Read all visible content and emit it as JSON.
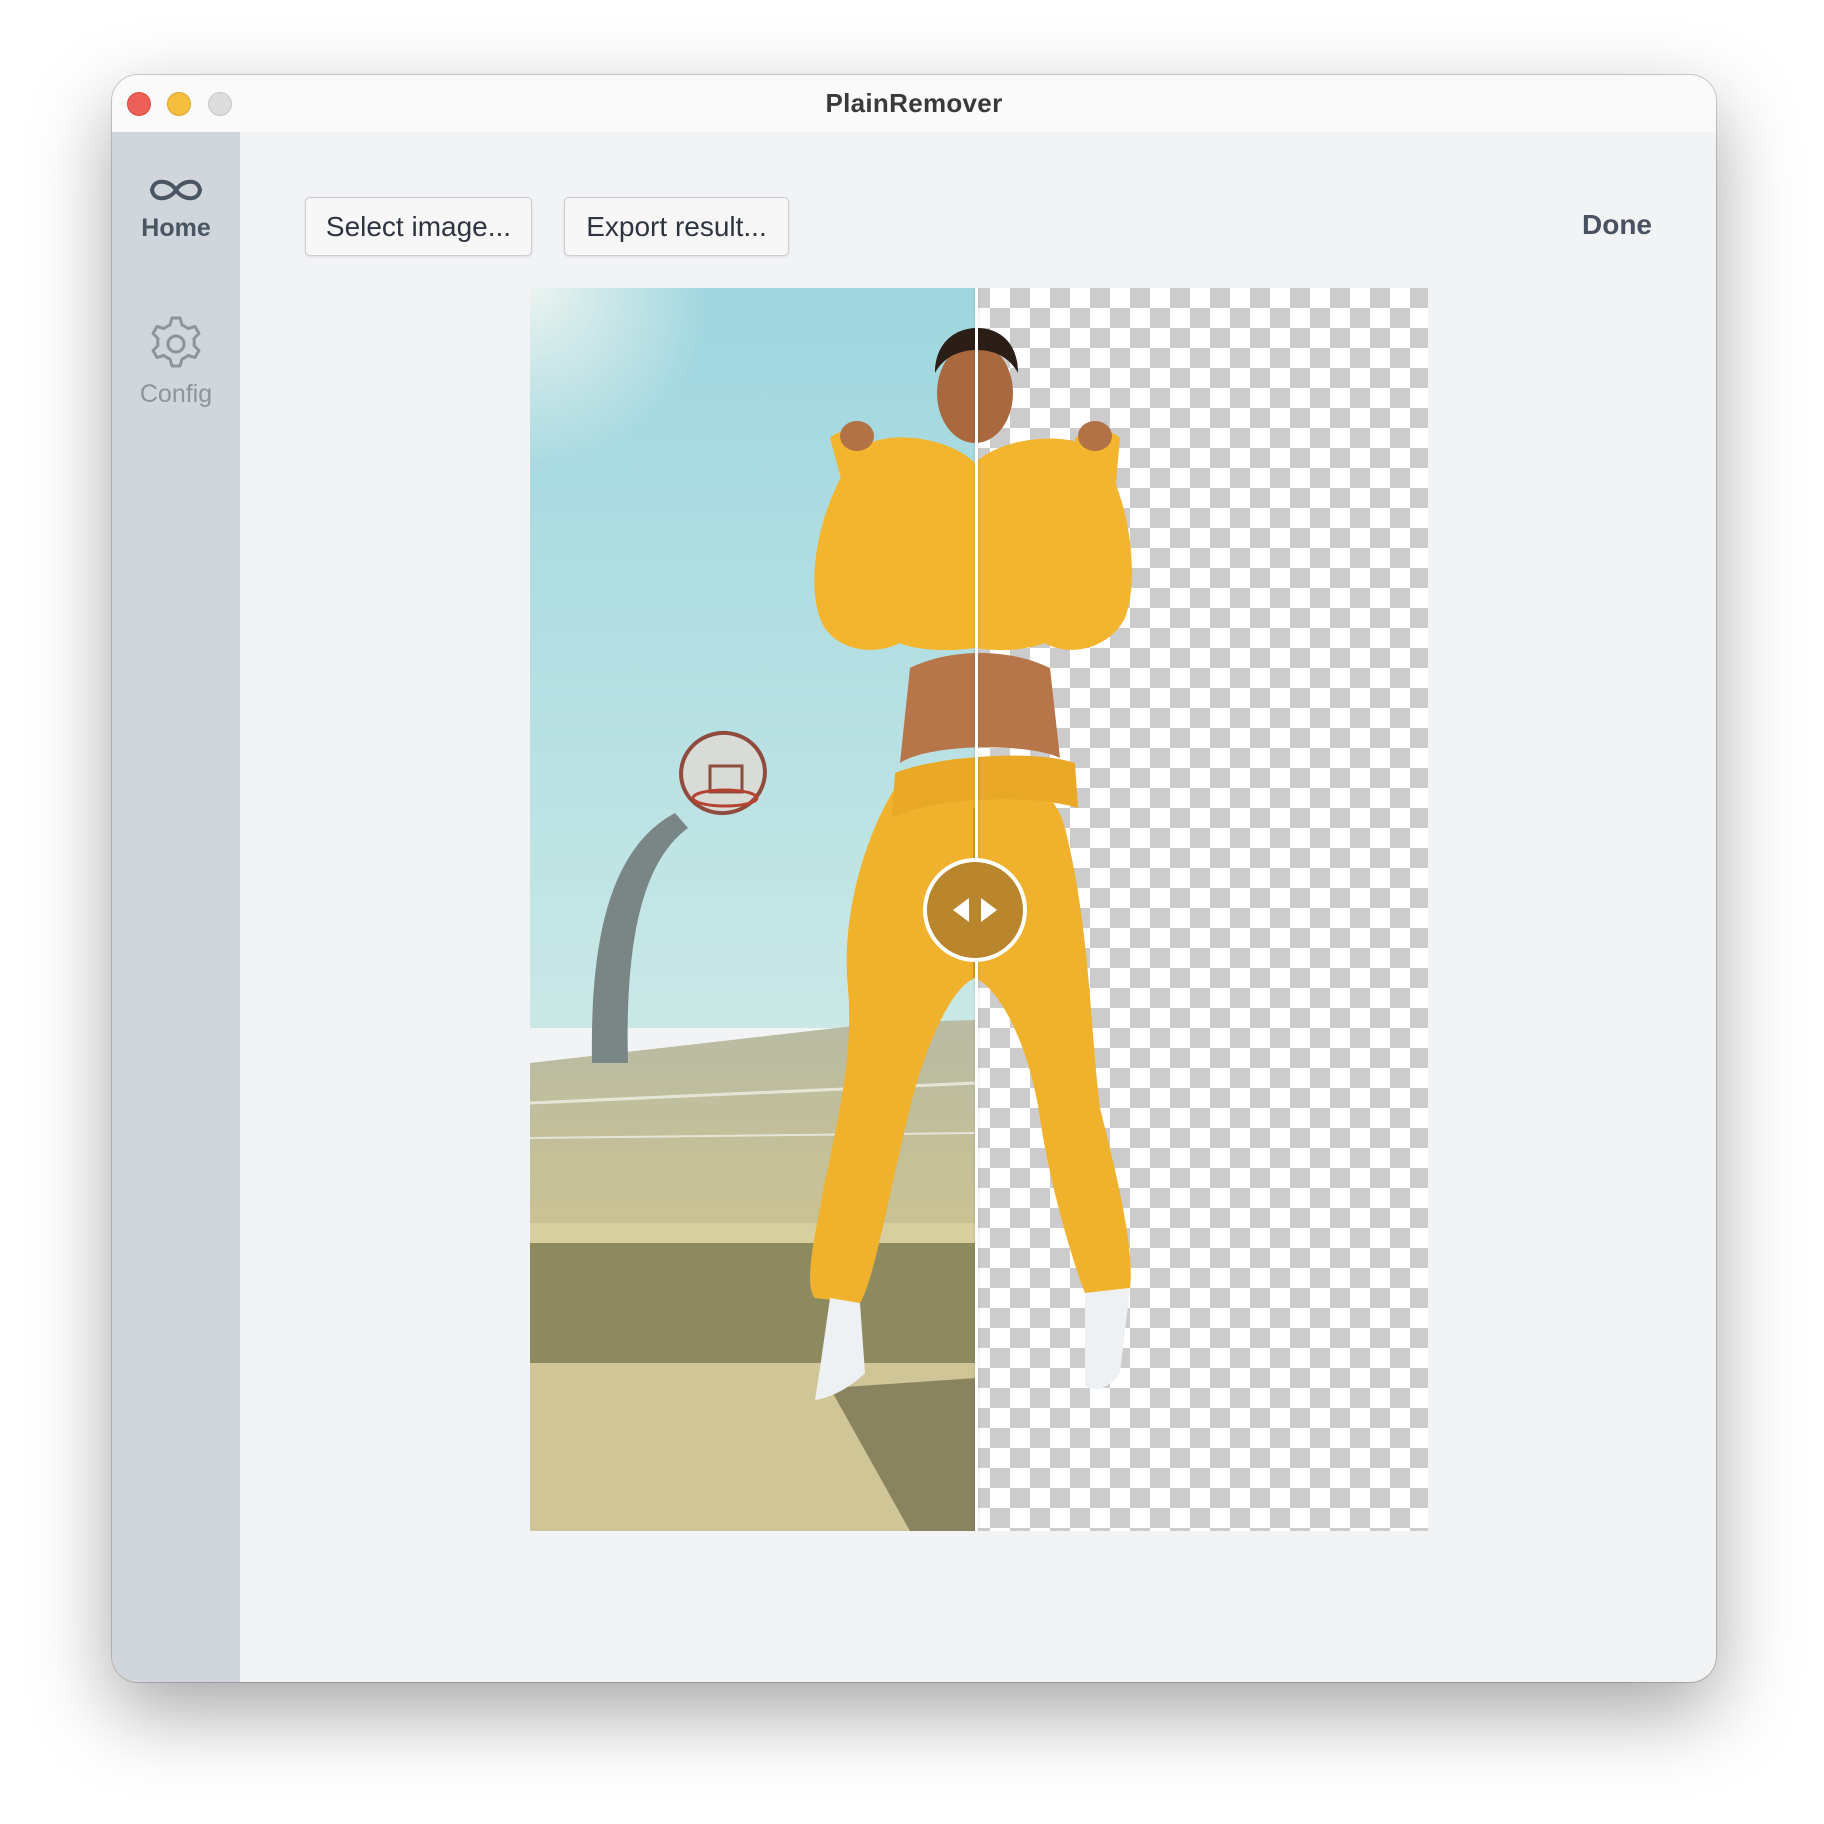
{
  "window": {
    "title": "PlainRemover"
  },
  "sidebar": {
    "items": [
      {
        "label": "Home",
        "icon": "infinity-icon",
        "active": true
      },
      {
        "label": "Config",
        "icon": "gear-icon",
        "active": false
      }
    ]
  },
  "toolbar": {
    "select_label": "Select image...",
    "export_label": "Export result...",
    "done_label": "Done"
  },
  "compare": {
    "divider_position": 0.497,
    "original_image": "woman in yellow hoodie and sweatpants at basketball court",
    "result_image": "background removed, transparent checkerboard"
  },
  "colors": {
    "accent_handle": "#b9852d",
    "sidebar_bg": "#d1d5dc",
    "content_bg": "#f2f3f5",
    "close": "#ee5f57",
    "minimize": "#f5be3f",
    "maximize": "#dcdcdc"
  }
}
